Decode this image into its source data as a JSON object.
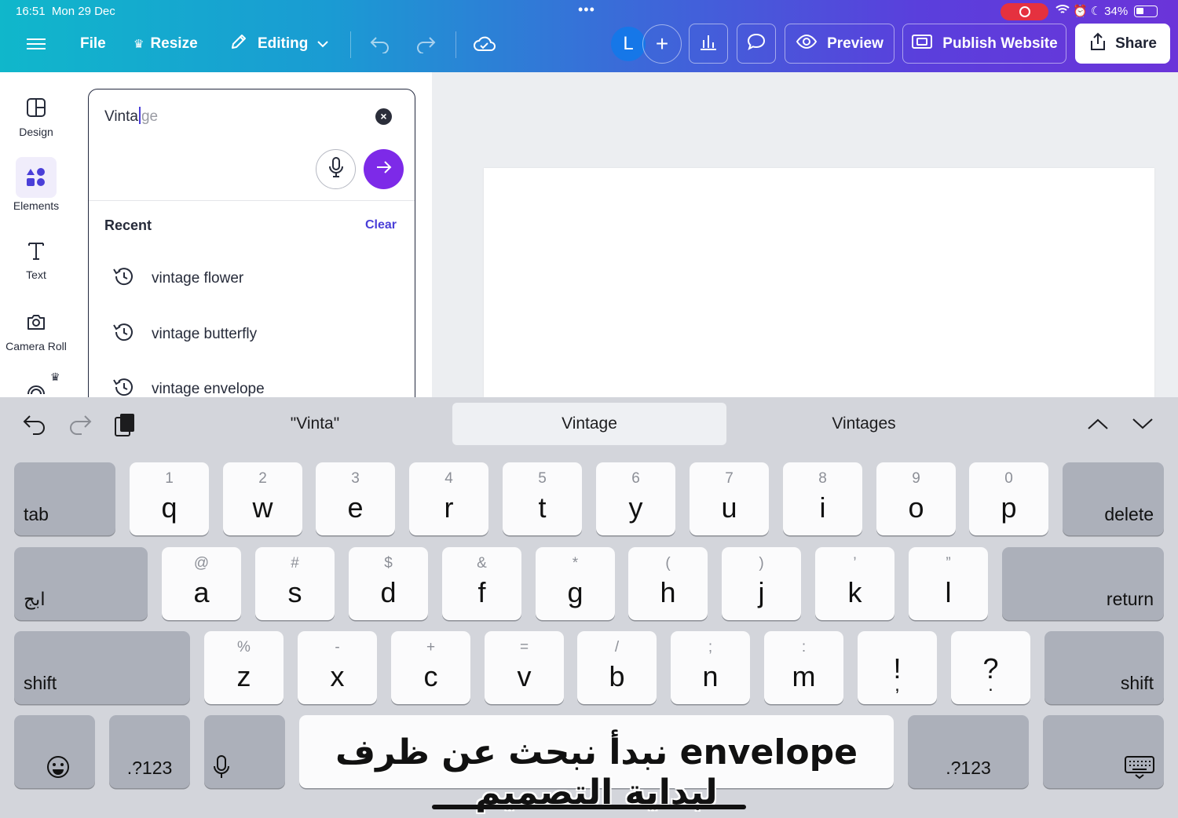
{
  "status": {
    "time": "16:51",
    "date": "Mon 29 Dec",
    "battery": "34%"
  },
  "toolbar": {
    "file": "File",
    "resize": "Resize",
    "editing": "Editing",
    "avatar_letter": "L",
    "preview": "Preview",
    "publish": "Publish Website",
    "share": "Share"
  },
  "rail": [
    {
      "label": "Design",
      "icon": "design-icon"
    },
    {
      "label": "Elements",
      "icon": "elements-icon"
    },
    {
      "label": "Text",
      "icon": "text-icon"
    },
    {
      "label": "Camera Roll",
      "icon": "camera-icon"
    }
  ],
  "search": {
    "typed": "Vinta",
    "completion": "ge",
    "recent_label": "Recent",
    "clear_label": "Clear",
    "recent": [
      "vintage flower",
      "vintage butterfly",
      "vintage envelope"
    ]
  },
  "keyboard": {
    "suggestions": [
      "\"Vinta\"",
      "Vintage",
      "Vintages"
    ],
    "row1": [
      {
        "k": "q",
        "s": "1"
      },
      {
        "k": "w",
        "s": "2"
      },
      {
        "k": "e",
        "s": "3"
      },
      {
        "k": "r",
        "s": "4"
      },
      {
        "k": "t",
        "s": "5"
      },
      {
        "k": "y",
        "s": "6"
      },
      {
        "k": "u",
        "s": "7"
      },
      {
        "k": "i",
        "s": "8"
      },
      {
        "k": "o",
        "s": "9"
      },
      {
        "k": "p",
        "s": "0"
      }
    ],
    "row2": [
      {
        "k": "a",
        "s": "@"
      },
      {
        "k": "s",
        "s": "#"
      },
      {
        "k": "d",
        "s": "$"
      },
      {
        "k": "f",
        "s": "&"
      },
      {
        "k": "g",
        "s": "*"
      },
      {
        "k": "h",
        "s": "("
      },
      {
        "k": "j",
        "s": ")"
      },
      {
        "k": "k",
        "s": "’"
      },
      {
        "k": "l",
        "s": "”"
      }
    ],
    "row3": [
      {
        "k": "z",
        "s": "%"
      },
      {
        "k": "x",
        "s": "-"
      },
      {
        "k": "c",
        "s": "+"
      },
      {
        "k": "v",
        "s": "="
      },
      {
        "k": "b",
        "s": "/"
      },
      {
        "k": "n",
        "s": ";"
      },
      {
        "k": "m",
        "s": ":"
      },
      {
        "k": "!",
        "s": ""
      },
      {
        "k": "?",
        "s": ""
      }
    ],
    "tab": "tab",
    "delete": "delete",
    "lang": "ابج",
    "return": "return",
    "shift": "shift",
    "numbers": ".?123",
    "caption": "نبدأ نبحث عن ظرف envelope لبداية التصميم"
  },
  "colors": {
    "accent": "#7d2ae8",
    "link": "#4a3fd8",
    "avatar": "#1677e8"
  }
}
